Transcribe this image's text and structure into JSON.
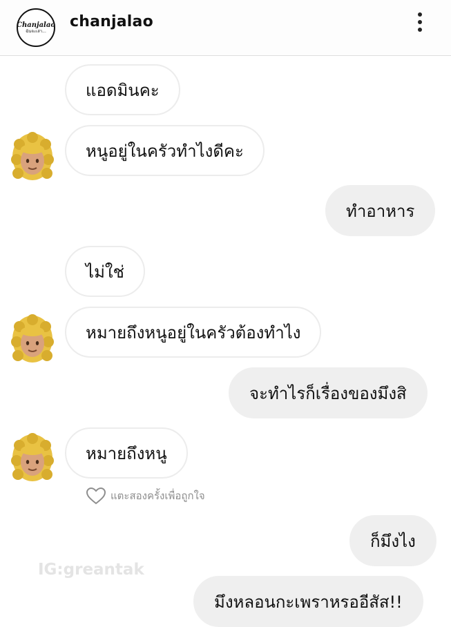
{
  "header": {
    "username": "chanjalao",
    "avatar_line1": "Chanjalao",
    "avatar_line2": "ฉันจะเล่า...",
    "menu_icon": "more-vertical-icon"
  },
  "messages": [
    {
      "side": "incoming",
      "text": "แอดมินคะ"
    },
    {
      "side": "incoming",
      "text": "หนูอยู่ในครัวทำไงดีคะ"
    },
    {
      "side": "outgoing",
      "text": "ทำอาหาร"
    },
    {
      "side": "incoming",
      "text": "ไม่ใช่"
    },
    {
      "side": "incoming",
      "text": "หมายถึงหนูอยู่ในครัวต้องทำไง"
    },
    {
      "side": "outgoing",
      "text": "จะทำไรก็เรื่องของมึงสิ"
    },
    {
      "side": "incoming",
      "text": "หมายถึงหนู"
    },
    {
      "side": "outgoing",
      "text": "ก็มึงไง"
    },
    {
      "side": "outgoing",
      "text": "มึงหลอนกะเพราหรออีสัส!!"
    }
  ],
  "like_hint": "แตะสองครั้งเพื่อถูกใจ",
  "watermark": "IG:greantak",
  "colors": {
    "outgoing_bubble": "#efefef",
    "incoming_border": "#ececec",
    "hair": "#e9c243",
    "skin": "#d9a27c"
  }
}
